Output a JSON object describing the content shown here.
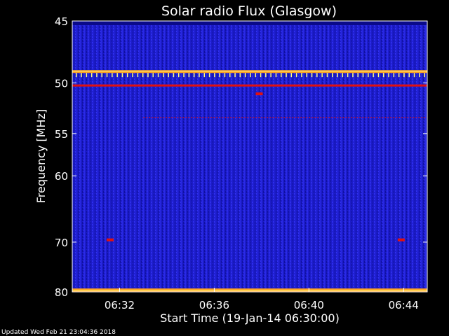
{
  "chart_data": {
    "type": "heatmap",
    "title": "Solar radio Flux (Glasgow)",
    "xlabel": "Start Time (19-Jan-14 06:30:00)",
    "ylabel": "Frequency [MHz]",
    "x_ticks": [
      "06:32",
      "06:36",
      "06:40",
      "06:44"
    ],
    "x_tick_minutes": [
      2,
      6,
      10,
      14
    ],
    "xlim_minutes": [
      0,
      15
    ],
    "y_ticks": [
      45,
      50,
      55,
      60,
      70,
      80
    ],
    "ylim": [
      45,
      80
    ],
    "y_scale": "reciprocal",
    "colors": {
      "background": "#1a1ad0",
      "low": "#0a0a8a",
      "high": "#ffa020",
      "peak": "#ffff80",
      "burst": "#e01010"
    },
    "bright_bands_mhz": [
      49.0,
      50.2,
      79.7
    ],
    "faint_band_mhz": 53.3,
    "spike_markers": [
      {
        "minute": 1.6,
        "mhz": 69.6
      },
      {
        "minute": 13.9,
        "mhz": 69.6
      },
      {
        "minute": 7.9,
        "mhz": 51.0
      }
    ],
    "grid": false,
    "legend": "none"
  },
  "footer": "Updated Wed Feb 21 23:04:36 2018"
}
